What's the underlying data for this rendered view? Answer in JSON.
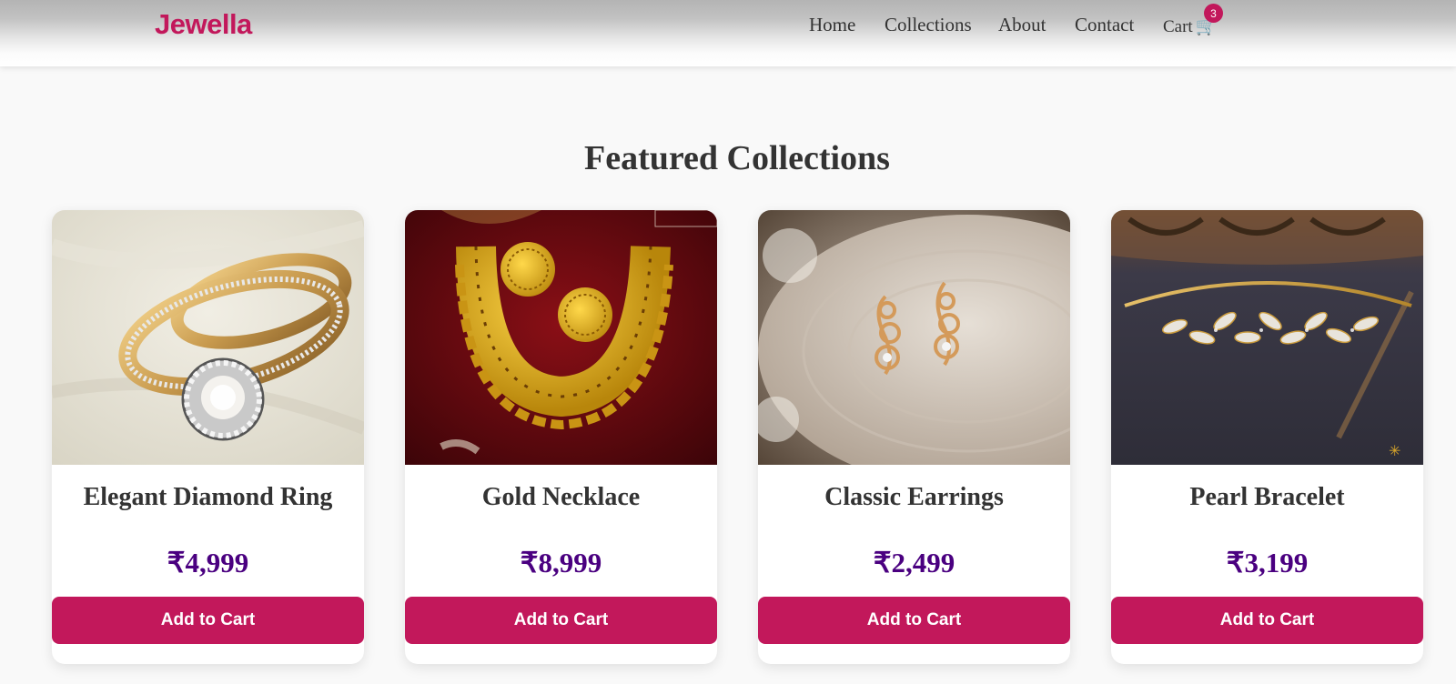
{
  "brand": {
    "name": "Jewella",
    "accent_color": "#c2185b"
  },
  "nav": {
    "links": [
      "Home",
      "Collections",
      "About",
      "Contact"
    ],
    "cart_label": "Cart",
    "cart_icon": "shopping-cart-icon",
    "cart_count": "3"
  },
  "section": {
    "title": "Featured Collections"
  },
  "products": [
    {
      "name": "Elegant Diamond Ring",
      "price": "₹4,999",
      "button": "Add to Cart",
      "image_icon": "diamond-ring-photo"
    },
    {
      "name": "Gold Necklace",
      "price": "₹8,999",
      "button": "Add to Cart",
      "image_icon": "gold-necklace-photo"
    },
    {
      "name": "Classic Earrings",
      "price": "₹2,499",
      "button": "Add to Cart",
      "image_icon": "earrings-photo"
    },
    {
      "name": "Pearl Bracelet",
      "price": "₹3,199",
      "button": "Add to Cart",
      "image_icon": "bracelet-photo"
    }
  ],
  "colors": {
    "price": "#4a0080",
    "button_bg": "#c2185b",
    "title": "#333333"
  }
}
